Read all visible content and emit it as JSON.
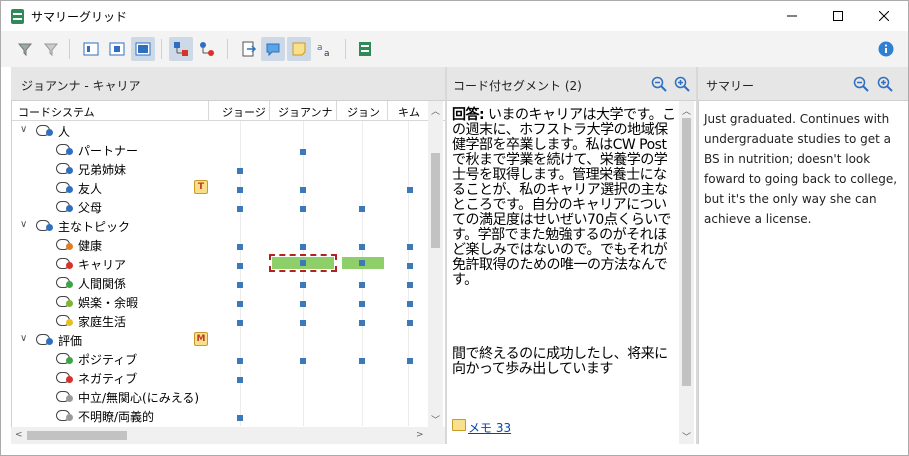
{
  "window": {
    "title": "サマリーグリッド"
  },
  "panels": {
    "grid_title": "ジョアンナ - キャリア",
    "segments_title": "コード付セグメント (2)",
    "summary_title": "サマリー"
  },
  "grid": {
    "header_code_system": "コードシステム",
    "columns": [
      "ジョージ",
      "ジョアンナ",
      "ジョン",
      "キム"
    ],
    "rows": [
      {
        "label": "人",
        "level": 0,
        "expanded": true,
        "dot": "#2f6fc0"
      },
      {
        "label": "パートナー",
        "level": 1,
        "dot": "#2f6fc0"
      },
      {
        "label": "兄弟姉妹",
        "level": 1,
        "dot": "#2f6fc0"
      },
      {
        "label": "友人",
        "level": 1,
        "dot": "#2f6fc0",
        "badge": "T"
      },
      {
        "label": "父母",
        "level": 1,
        "dot": "#2f6fc0"
      },
      {
        "label": "主なトピック",
        "level": 0,
        "expanded": true,
        "dot": "#2f6fc0"
      },
      {
        "label": "健康",
        "level": 1,
        "dot": "#e37b22"
      },
      {
        "label": "キャリア",
        "level": 1,
        "dot": "#d9322b"
      },
      {
        "label": "人間関係",
        "level": 1,
        "dot": "#3aa640"
      },
      {
        "label": "娯楽・余暇",
        "level": 1,
        "dot": "#7cb82f"
      },
      {
        "label": "家庭生活",
        "level": 1,
        "dot": "#e5c21b"
      },
      {
        "label": "評価",
        "level": 0,
        "expanded": true,
        "dot": "#2f6fc0",
        "badge": "M"
      },
      {
        "label": "ポジティブ",
        "level": 1,
        "dot": "#3aa640"
      },
      {
        "label": "ネガティブ",
        "level": 1,
        "dot": "#d9322b"
      },
      {
        "label": "中立/無関心(にみえる)",
        "level": 1,
        "dot": "#9a9a9a"
      },
      {
        "label": "不明瞭/両義的",
        "level": 1,
        "dot": "#9a9a9a"
      }
    ]
  },
  "segment": {
    "answer_label": "回答:",
    "para1": " いまのキャリアは大学です。この週末に、ホフストラ大学の地域保健学部を卒業します。私はCW Postで秋まで学業を続けて、栄養学の学士号を取得します。管理栄養士になることが、私のキャリア選択の主なところです。自分のキャリアについての満足度はせいぜい70点くらいです。学部でまた勉強するのがそれほど楽しみではないので。でもそれが免許取得のための唯一の方法なんです。",
    "para2": "間で終えるのに成功したし、将来に向かって歩み出しています",
    "memo_link": "メモ 33"
  },
  "summary": {
    "text": "Just graduated. Continues with undergraduate studies to get a BS in nutrition; doesn't look foward to going back to college, but it's the only way she can achieve a license."
  },
  "colors": {
    "accent": "#3d78b8",
    "bar": "#8fcf6a",
    "memo": "#f9e08a"
  }
}
